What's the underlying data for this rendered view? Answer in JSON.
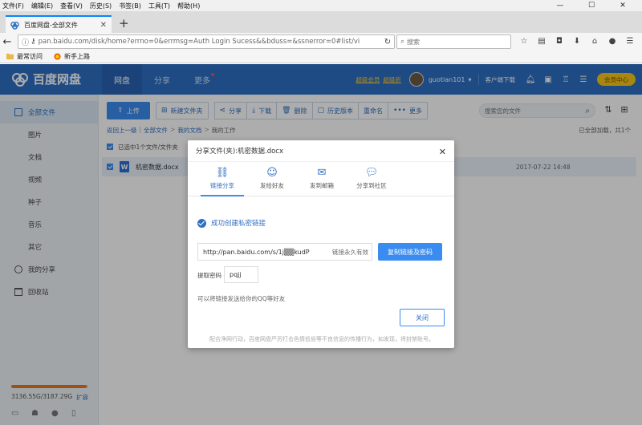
{
  "browser": {
    "menu": [
      "文件(F)",
      "编辑(E)",
      "查看(V)",
      "历史(S)",
      "书签(B)",
      "工具(T)",
      "帮助(H)"
    ],
    "window_controls": [
      "—",
      "☐",
      "✕"
    ],
    "tab_title": "百度网盘-全部文件",
    "new_tab": "+",
    "url": "pan.baidu.com/disk/home?errno=0&errmsg=Auth Login Sucess&&bduss=&ssnerror=0#list/vi",
    "search_placeholder": "搜索",
    "bookmarks": [
      "最常访问",
      "新手上路"
    ]
  },
  "header": {
    "logo": "百度网盘",
    "nav": [
      "网盘",
      "分享",
      "更多"
    ],
    "vip_links": [
      "超级会员",
      "超级折"
    ],
    "username": "guotian101",
    "client": "客户端下载",
    "vip_button": "会员中心"
  },
  "sidebar": {
    "items": [
      {
        "label": "全部文件",
        "top": true,
        "active": true
      },
      {
        "label": "图片"
      },
      {
        "label": "文档"
      },
      {
        "label": "视频"
      },
      {
        "label": "种子"
      },
      {
        "label": "音乐"
      },
      {
        "label": "其它"
      },
      {
        "label": "我的分享",
        "top": true
      },
      {
        "label": "回收站",
        "top": true
      }
    ],
    "quota": "3136.55G/3187.29G",
    "quota_fraction": 0.984,
    "expand": "扩容"
  },
  "toolbar": {
    "upload": "上传",
    "new_folder": "新建文件夹",
    "share": "分享",
    "download": "下载",
    "delete": "删除",
    "history": "历史版本",
    "rename": "重命名",
    "more": "更多",
    "search_placeholder": "搜索您的文件"
  },
  "breadcrumb": {
    "back": "返回上一级",
    "all": "全部文件",
    "docs": "我的文档",
    "current": "我的工作",
    "loaded": "已全部加载，共1个"
  },
  "selection": {
    "text": "已选中1个文件/文件夹"
  },
  "file": {
    "icon_letter": "W",
    "name": "机密数据.docx",
    "date": "2017-07-22 14:48"
  },
  "modal": {
    "title": "分享文件(夹):机密数据.docx",
    "tabs": [
      "链接分享",
      "发给好友",
      "发到邮箱",
      "分享到社区"
    ],
    "success": "成功创建私密链接",
    "link": "http://pan.baidu.com/s/1j▒▒kudP",
    "link_validity": "链接永久有效",
    "copy_button": "复制链接及密码",
    "password_label": "提取密码",
    "password": "pqjj",
    "hint": "可以将链接发送给你的QQ等好友",
    "close_button": "关闭",
    "disclaimer": "配合净网行动，百度网盘严厉打击色情低俗等不良信息的传播行为，如发现，将封禁账号。"
  }
}
